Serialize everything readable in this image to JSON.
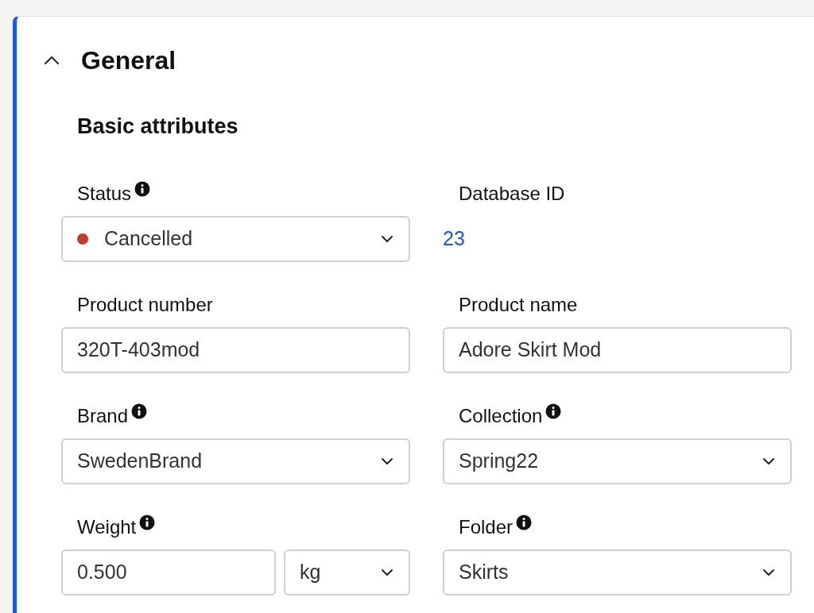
{
  "section": {
    "title": "General",
    "expanded": true,
    "subsection": {
      "title": "Basic attributes",
      "fields": [
        {
          "kind": "select",
          "label": "Status",
          "info": true,
          "value": "Cancelled",
          "color": "#c0392b"
        },
        {
          "kind": "link",
          "label": "Database ID",
          "info": false,
          "value": "23"
        },
        {
          "kind": "text",
          "label": "Product number",
          "info": false,
          "value": "320T-403mod"
        },
        {
          "kind": "text",
          "label": "Product name",
          "info": false,
          "value": "Adore Skirt Mod"
        },
        {
          "kind": "select",
          "label": "Brand",
          "info": true,
          "value": "SwedenBrand"
        },
        {
          "kind": "select",
          "label": "Collection",
          "info": true,
          "value": "Spring22"
        },
        {
          "kind": "measure",
          "label": "Weight",
          "info": true,
          "value": "0.500",
          "unit": "kg"
        },
        {
          "kind": "select",
          "label": "Folder",
          "info": true,
          "value": "Skirts"
        }
      ]
    }
  }
}
